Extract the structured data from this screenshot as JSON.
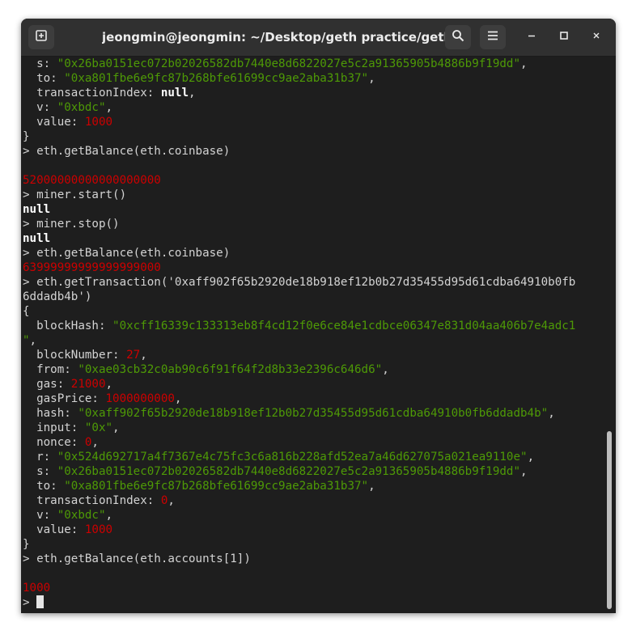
{
  "window": {
    "title": "jeongmin@jeongmin: ~/Desktop/geth practice/gethPoW",
    "icons": {
      "new_tab": "new-tab-icon",
      "search": "search-icon",
      "menu": "hamburger-menu-icon",
      "minimize": "minimize-icon",
      "maximize": "maximize-icon",
      "close": "close-icon"
    }
  },
  "colors": {
    "string": "#4e9a06",
    "number": "#cc0000",
    "text": "#d3d3d3",
    "background": "#1e1e1e",
    "titlebar": "#303030"
  },
  "terminal": {
    "lines": [
      [
        [
          "  s: ",
          ""
        ],
        [
          "\"0x26ba0151ec072b02026582db7440e8d6822027e5c2a91365905b4886b9f19dd\"",
          "str"
        ],
        [
          ",",
          ""
        ]
      ],
      [
        [
          "  to: ",
          ""
        ],
        [
          "\"0xa801fbe6e9fc87b268bfe61699cc9ae2aba31b37\"",
          "str"
        ],
        [
          ",",
          ""
        ]
      ],
      [
        [
          "  transactionIndex: ",
          ""
        ],
        [
          "null",
          "kw"
        ],
        [
          ",",
          ""
        ]
      ],
      [
        [
          "  v: ",
          ""
        ],
        [
          "\"0xbdc\"",
          "str"
        ],
        [
          ",",
          ""
        ]
      ],
      [
        [
          "  value: ",
          ""
        ],
        [
          "1000",
          "num"
        ]
      ],
      [
        [
          "}",
          ""
        ]
      ],
      [
        [
          "> eth.getBalance(eth.coinbase)",
          ""
        ]
      ],
      [],
      [
        [
          "52000000000000000000",
          "num"
        ]
      ],
      [
        [
          "> miner.start()",
          ""
        ]
      ],
      [
        [
          "null",
          "kw"
        ]
      ],
      [
        [
          "> miner.stop()",
          ""
        ]
      ],
      [
        [
          "null",
          "kw"
        ]
      ],
      [
        [
          "> eth.getBalance(eth.coinbase)",
          ""
        ]
      ],
      [
        [
          "63999999999999999000",
          "num"
        ]
      ],
      [
        [
          "> eth.getTransaction('0xaff902f65b2920de18b918ef12b0b27d35455d95d61cdba64910b0fb",
          ""
        ]
      ],
      [
        [
          "6ddadb4b')",
          ""
        ]
      ],
      [
        [
          "{",
          ""
        ]
      ],
      [
        [
          "  blockHash: ",
          ""
        ],
        [
          "\"0xcff16339c133313eb8f4cd12f0e6ce84e1cdbce06347e831d04aa406b7e4adc1",
          "str"
        ]
      ],
      [
        [
          "\"",
          "str"
        ],
        [
          ",",
          ""
        ]
      ],
      [
        [
          "  blockNumber: ",
          ""
        ],
        [
          "27",
          "num"
        ],
        [
          ",",
          ""
        ]
      ],
      [
        [
          "  from: ",
          ""
        ],
        [
          "\"0xae03cb32c0ab90c6f91f64f2d8b33e2396c646d6\"",
          "str"
        ],
        [
          ",",
          ""
        ]
      ],
      [
        [
          "  gas: ",
          ""
        ],
        [
          "21000",
          "num"
        ],
        [
          ",",
          ""
        ]
      ],
      [
        [
          "  gasPrice: ",
          ""
        ],
        [
          "1000000000",
          "num"
        ],
        [
          ",",
          ""
        ]
      ],
      [
        [
          "  hash: ",
          ""
        ],
        [
          "\"0xaff902f65b2920de18b918ef12b0b27d35455d95d61cdba64910b0fb6ddadb4b\"",
          "str"
        ],
        [
          ",",
          ""
        ]
      ],
      [
        [
          "  input: ",
          ""
        ],
        [
          "\"0x\"",
          "str"
        ],
        [
          ",",
          ""
        ]
      ],
      [
        [
          "  nonce: ",
          ""
        ],
        [
          "0",
          "num"
        ],
        [
          ",",
          ""
        ]
      ],
      [
        [
          "  r: ",
          ""
        ],
        [
          "\"0x524d692717a4f7367e4c75fc3c6a816b228afd52ea7a46d627075a021ea9110e\"",
          "str"
        ],
        [
          ",",
          ""
        ]
      ],
      [
        [
          "  s: ",
          ""
        ],
        [
          "\"0x26ba0151ec072b02026582db7440e8d6822027e5c2a91365905b4886b9f19dd\"",
          "str"
        ],
        [
          ",",
          ""
        ]
      ],
      [
        [
          "  to: ",
          ""
        ],
        [
          "\"0xa801fbe6e9fc87b268bfe61699cc9ae2aba31b37\"",
          "str"
        ],
        [
          ",",
          ""
        ]
      ],
      [
        [
          "  transactionIndex: ",
          ""
        ],
        [
          "0",
          "num"
        ],
        [
          ",",
          ""
        ]
      ],
      [
        [
          "  v: ",
          ""
        ],
        [
          "\"0xbdc\"",
          "str"
        ],
        [
          ",",
          ""
        ]
      ],
      [
        [
          "  value: ",
          ""
        ],
        [
          "1000",
          "num"
        ]
      ],
      [
        [
          "}",
          ""
        ]
      ],
      [
        [
          "> eth.getBalance(eth.accounts[1])",
          ""
        ]
      ],
      [],
      [
        [
          "1000",
          "num"
        ]
      ]
    ],
    "prompt": "> "
  }
}
